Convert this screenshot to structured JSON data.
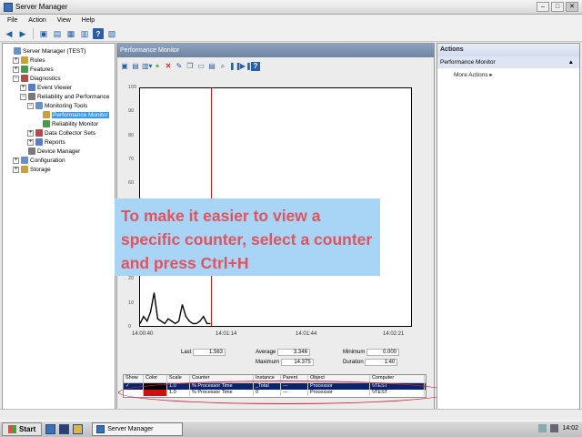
{
  "window": {
    "title": "Server Manager"
  },
  "menubar": [
    "File",
    "Action",
    "View",
    "Help"
  ],
  "tree": [
    {
      "label": "Server Manager (TEST)",
      "level": 0,
      "expander": ""
    },
    {
      "label": "Roles",
      "level": 1,
      "expander": "+"
    },
    {
      "label": "Features",
      "level": 1,
      "expander": "+"
    },
    {
      "label": "Diagnostics",
      "level": 1,
      "expander": "-"
    },
    {
      "label": "Event Viewer",
      "level": 2,
      "expander": "+"
    },
    {
      "label": "Reliability and Performance",
      "level": 2,
      "expander": "-"
    },
    {
      "label": "Monitoring Tools",
      "level": 3,
      "expander": "-"
    },
    {
      "label": "Performance Monitor",
      "level": 4,
      "expander": "",
      "selected": true
    },
    {
      "label": "Reliability Monitor",
      "level": 4,
      "expander": ""
    },
    {
      "label": "Data Collector Sets",
      "level": 3,
      "expander": "+"
    },
    {
      "label": "Reports",
      "level": 3,
      "expander": "+"
    },
    {
      "label": "Device Manager",
      "level": 2,
      "expander": ""
    },
    {
      "label": "Configuration",
      "level": 1,
      "expander": "+"
    },
    {
      "label": "Storage",
      "level": 1,
      "expander": "+"
    }
  ],
  "center": {
    "header": "Performance Monitor",
    "yticks": [
      "100",
      "90",
      "80",
      "70",
      "60",
      "50",
      "40",
      "30",
      "20",
      "10",
      "0"
    ],
    "xticks": [
      "14:00:40",
      "14:01:14",
      "14:01:44",
      "14:02:21"
    ]
  },
  "stats": {
    "last_label": "Last",
    "last_value": "1.563",
    "average_label": "Average",
    "average_value": "3.346",
    "minimum_label": "Minimum",
    "minimum_value": "0.000",
    "maximum_label": "Maximum",
    "maximum_value": "14.375",
    "duration_label": "Duration",
    "duration_value": "1:40"
  },
  "counter_table": {
    "headers": [
      "Show",
      "Color",
      "Scale",
      "Counter",
      "Instance",
      "Parent",
      "Object",
      "Computer"
    ],
    "rows": [
      [
        "✓",
        "",
        "1.0",
        "% Processor Time",
        "_Total",
        "---",
        "Processor",
        "\\\\TEST"
      ],
      [
        "",
        "",
        "1.0",
        "% Processor Time",
        "0",
        "---",
        "Processor",
        "\\\\TEST"
      ]
    ]
  },
  "callout": {
    "text": "To make it easier to view a specific counter, select a counter and press Ctrl+H"
  },
  "actions": {
    "header": "Actions",
    "section": "Performance Monitor",
    "more": "More Actions"
  },
  "taskbar": {
    "start_label": "Start",
    "task_label": "Server Manager",
    "clock": "14:02"
  },
  "chart_data": {
    "type": "line",
    "x": [
      0,
      2,
      4,
      6,
      8,
      10,
      12,
      14,
      16,
      18,
      20,
      22,
      24,
      26,
      28,
      30,
      32,
      34,
      36,
      38,
      40
    ],
    "values": [
      1,
      4,
      2,
      6,
      14,
      3,
      2,
      1,
      3,
      2,
      1,
      2,
      9,
      4,
      2,
      1,
      1,
      2,
      4,
      1,
      1
    ],
    "ylim": [
      0,
      100
    ],
    "colors": {
      "series": "#000000",
      "cursor": "#d01010"
    }
  }
}
